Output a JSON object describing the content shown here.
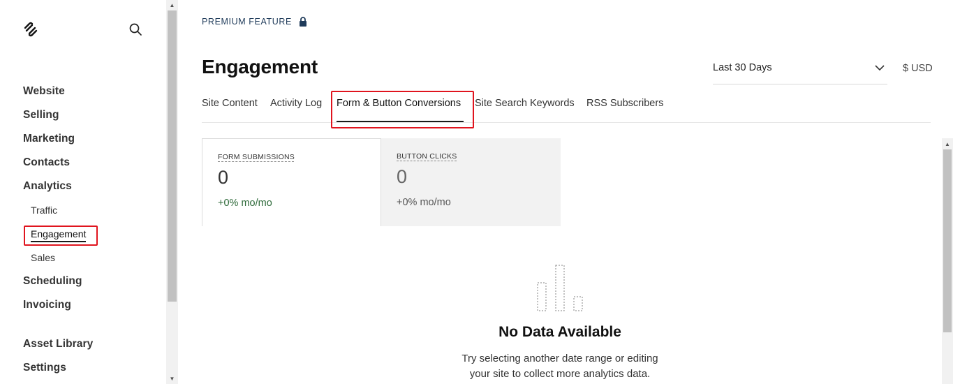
{
  "sidebar": {
    "items": [
      {
        "label": "Website"
      },
      {
        "label": "Selling"
      },
      {
        "label": "Marketing"
      },
      {
        "label": "Contacts"
      },
      {
        "label": "Analytics"
      },
      {
        "label": "Traffic"
      },
      {
        "label": "Engagement"
      },
      {
        "label": "Sales"
      },
      {
        "label": "Scheduling"
      },
      {
        "label": "Invoicing"
      },
      {
        "label": "Asset Library"
      },
      {
        "label": "Settings"
      }
    ]
  },
  "header": {
    "premium_label": "PREMIUM FEATURE",
    "title": "Engagement",
    "date_range": "Last 30 Days",
    "currency": "$ USD"
  },
  "tabs": [
    {
      "label": "Site Content"
    },
    {
      "label": "Activity Log"
    },
    {
      "label": "Form & Button Conversions"
    },
    {
      "label": "Site Search Keywords"
    },
    {
      "label": "RSS Subscribers"
    }
  ],
  "cards": [
    {
      "label": "FORM SUBMISSIONS",
      "value": "0",
      "delta": "+0% mo/mo"
    },
    {
      "label": "BUTTON CLICKS",
      "value": "0",
      "delta": "+0% mo/mo"
    }
  ],
  "empty_state": {
    "title": "No Data Available",
    "line1": "Try selecting another date range or editing",
    "line2": "your site to collect more analytics data."
  },
  "colors": {
    "highlight": "#e0141e",
    "positive_delta": "#2e6a3a",
    "premium_text": "#1f3b5a"
  }
}
